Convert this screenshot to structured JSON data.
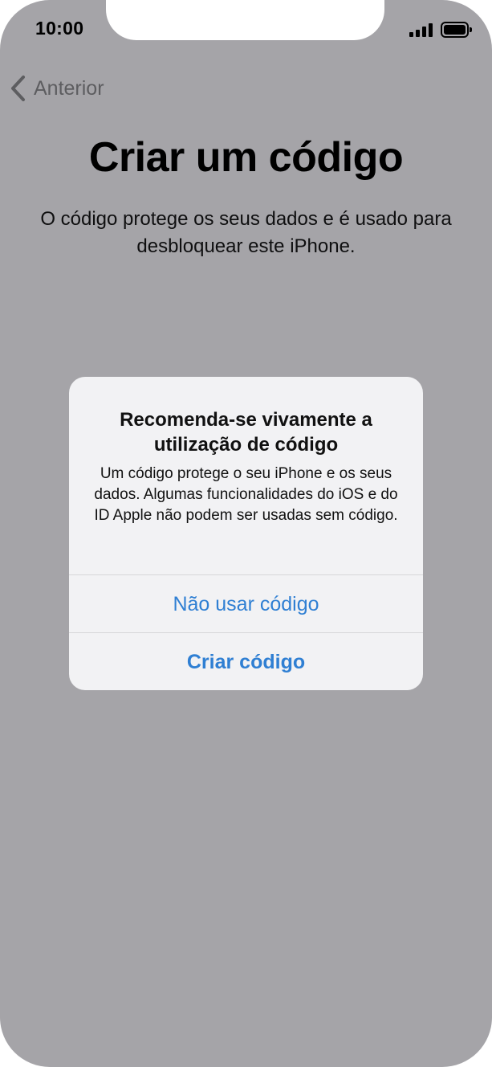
{
  "status_bar": {
    "time": "10:00",
    "signal_icon": "cellular-signal-icon",
    "battery_icon": "battery-icon"
  },
  "nav": {
    "back_label": "Anterior",
    "back_icon": "chevron-left-icon"
  },
  "page": {
    "title": "Criar um código",
    "subtitle": "O código protege os seus dados e é usado para desbloquear este iPhone."
  },
  "alert": {
    "title": "Recomenda-se vivamente a utilização de código",
    "message": "Um código protege o seu iPhone e os seus dados. Algumas funcionalidades do iOS e do ID Apple não podem ser usadas sem código.",
    "buttons": {
      "skip_label": "Não usar código",
      "create_label": "Criar código"
    }
  },
  "colors": {
    "background_dim": "#a5a4a8",
    "alert_background": "#f2f2f4",
    "action_blue": "#2f7fd3",
    "back_gray": "#5d5d60"
  }
}
